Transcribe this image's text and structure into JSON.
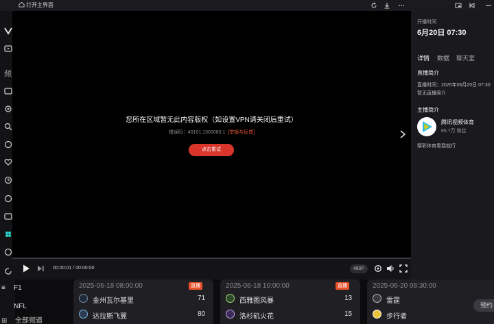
{
  "topbar": {
    "home_label": "打开主界面",
    "icons": [
      "refresh-icon",
      "download-icon",
      "more-icon",
      "pip-icon",
      "pin-icon",
      "minimize-icon"
    ]
  },
  "sidebar": {
    "partial_label": "频",
    "f1_label": "F1",
    "nfl_label": "NFL",
    "all_label": "全部频道"
  },
  "player": {
    "error_title": "您所在区域暂无此内容版权（如设置VPN请关闭后重试）",
    "error_code_prefix": "错误码：40101,1300080.1",
    "report_link": "[举报与反馈]",
    "retry_button": "点击重试",
    "time_display": "00:00:01 / 00:00:00",
    "quality": "480P"
  },
  "right_panel": {
    "start_label": "开播时间",
    "start_time": "6月20日 07:30",
    "tabs": [
      {
        "label": "详情",
        "active": true
      },
      {
        "label": "数据",
        "active": false
      },
      {
        "label": "聊天室",
        "active": false
      }
    ],
    "live_intro_title": "直播简介",
    "live_time_line": "直播时间：2025年06月20日 07:30",
    "live_intro_text": "暂无直播简介",
    "host_intro_title": "主播简介",
    "host_name": "腾讯视频体育",
    "host_fans": "65.7万 粉丝",
    "host_desc": "精彩体育看我就行"
  },
  "matches": [
    {
      "time": "2025-06-18 08:00:00",
      "badge": "直播",
      "teams": [
        {
          "name": "金州瓦尔基里",
          "score": "71"
        },
        {
          "name": "达拉斯飞翼",
          "score": "80"
        }
      ]
    },
    {
      "time": "2025-06-18 10:00:00",
      "badge": "直播",
      "teams": [
        {
          "name": "西雅图风暴",
          "score": "13"
        },
        {
          "name": "洛杉矶火花",
          "score": "15"
        }
      ]
    },
    {
      "time": "2025-06-20 08:30:00",
      "badge": "",
      "teams": [
        {
          "name": "雷霆",
          "score": ""
        },
        {
          "name": "步行者",
          "score": ""
        }
      ],
      "reserve_label": "预约"
    }
  ],
  "colors": {
    "accent_red": "#d9352b",
    "badge_orange": "#e8522a",
    "panel_bg": "#1a1a1e",
    "video_bg": "#000000"
  }
}
